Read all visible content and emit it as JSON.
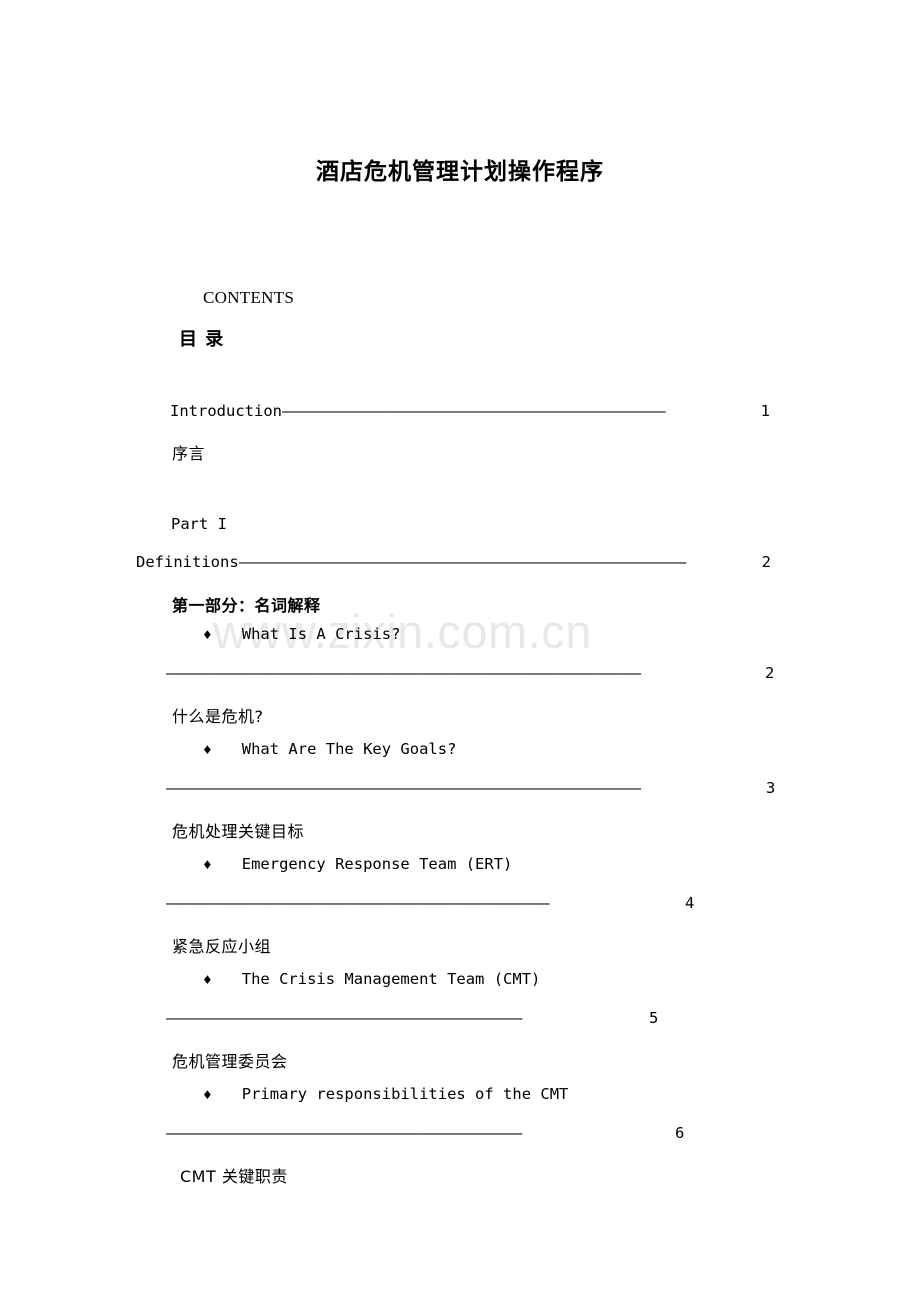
{
  "document": {
    "title": "酒店危机管理计划操作程序",
    "watermark": "www.zixin.com.cn"
  },
  "contents_heading": {
    "english": "CONTENTS",
    "chinese": "目    录"
  },
  "toc": {
    "introduction": {
      "label": "Introduction",
      "dashes": "——————————————————————————————————————————",
      "page": "1",
      "chinese": "序言"
    },
    "part1": {
      "part_label": "Part I",
      "label": "Definitions",
      "dashes": "—————————————————————————————————————————————————",
      "page": "2",
      "chinese": "第一部分：名词解释"
    },
    "entries": [
      {
        "bullet": "♦",
        "label": "What Is A Crisis?",
        "dashes": "————————————————————————————————————————————————————",
        "page": "2",
        "chinese": "什么是危机?"
      },
      {
        "bullet": "♦",
        "label": "What Are The Key Goals?",
        "dashes": "————————————————————————————————————————————————————",
        "page": "3",
        "chinese": "危机处理关键目标"
      },
      {
        "bullet": "♦",
        "label": "Emergency Response Team (ERT)",
        "dashes": "——————————————————————————————————————————",
        "page": "4",
        "chinese": "紧急反应小组"
      },
      {
        "bullet": "♦",
        "label": "The Crisis Management Team (CMT)",
        "dashes": "———————————————————————————————————————",
        "page": "5",
        "chinese": "危机管理委员会"
      },
      {
        "bullet": "♦",
        "label": "Primary responsibilities of the CMT",
        "dashes": "———————————————————————————————————————",
        "page": "6",
        "chinese": "CMT 关键职责"
      }
    ]
  }
}
